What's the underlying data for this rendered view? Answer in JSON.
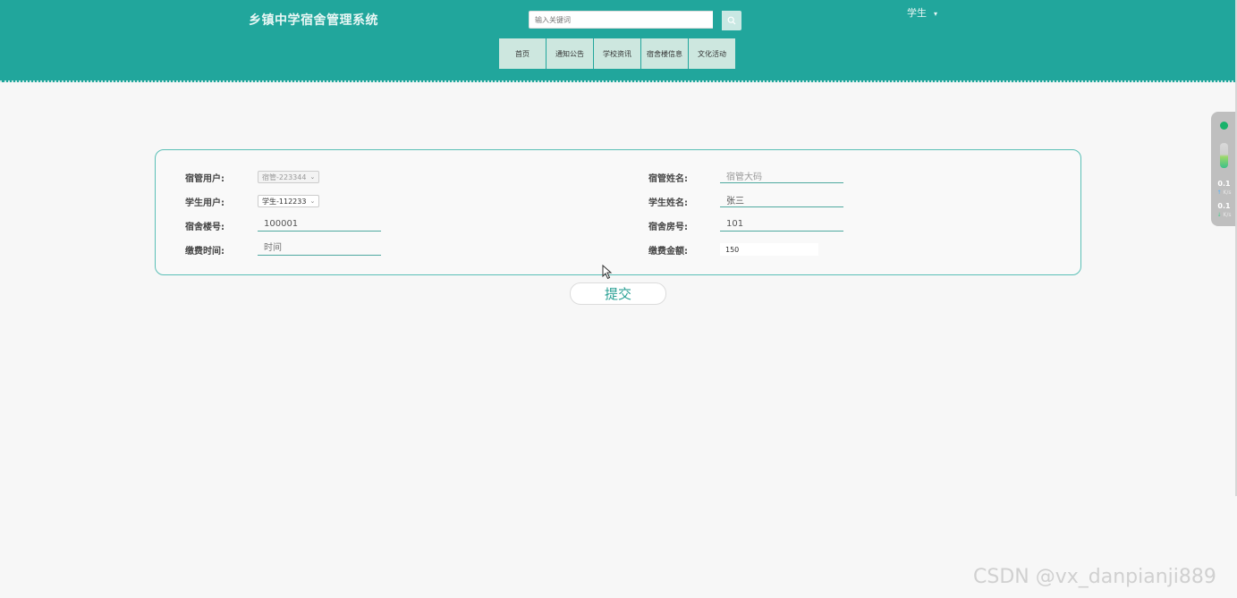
{
  "header": {
    "title": "乡镇中学宿舍管理系统",
    "search_placeholder": "输入关键词",
    "user_label": "学生",
    "user_caret": "▾",
    "nav": [
      {
        "label": "首页"
      },
      {
        "label": "通知公告"
      },
      {
        "label": "学校资讯"
      },
      {
        "label": "宿舍楼信息"
      },
      {
        "label": "文化活动"
      }
    ]
  },
  "form": {
    "supervisor_user_label": "宿管用户:",
    "supervisor_user_value": "宿管-223344",
    "supervisor_name_label": "宿管姓名:",
    "supervisor_name_value": "宿管大码",
    "student_user_label": "学生用户:",
    "student_user_value": "学生-112233",
    "student_name_label": "学生姓名:",
    "student_name_value": "张三",
    "building_label": "宿舍楼号:",
    "building_value": "100001",
    "room_label": "宿舍房号:",
    "room_value": "101",
    "pay_time_label": "缴费时间:",
    "pay_time_placeholder": "时间",
    "pay_amount_label": "缴费金额:",
    "pay_amount_value": "150",
    "submit_label": "提交"
  },
  "side_widget": {
    "upload_value": "0.1",
    "upload_unit": "K/s",
    "download_value": "0.1",
    "download_unit": "K/s"
  },
  "watermark": "CSDN @vx_danpianji889",
  "icons": {
    "search": "search-icon",
    "caret": "chevron-down-icon",
    "cursor": "mouse-cursor-icon"
  }
}
